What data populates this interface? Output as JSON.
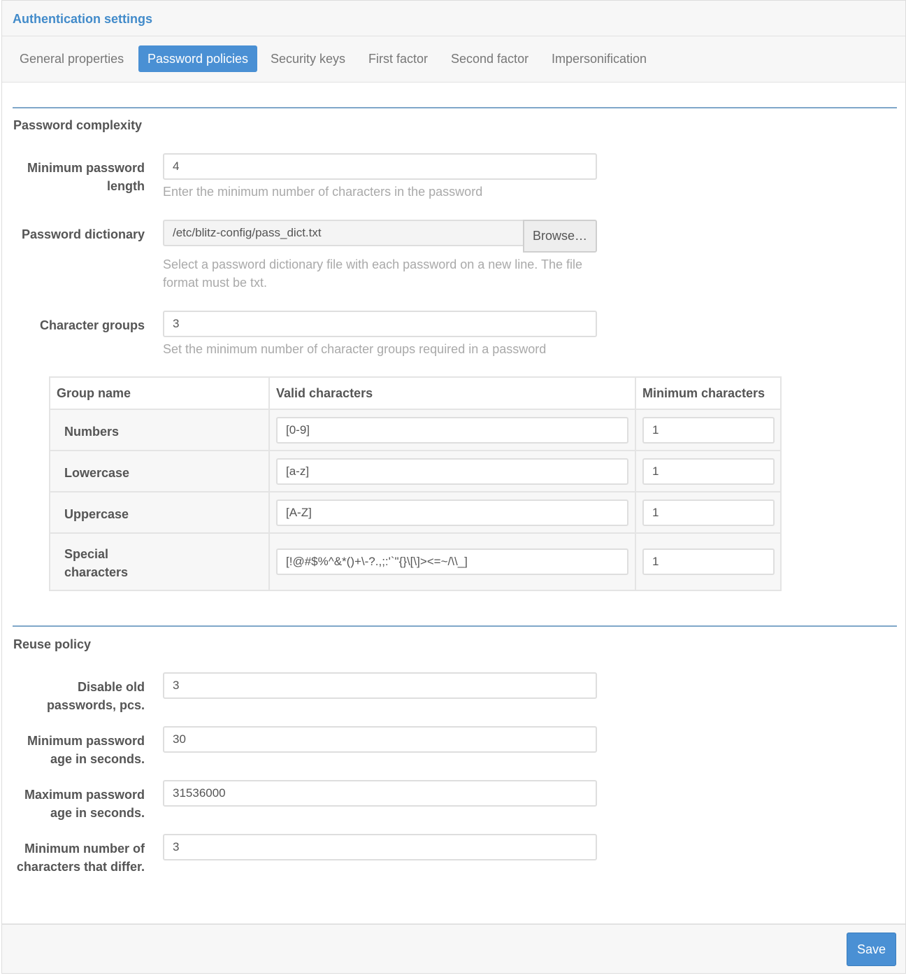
{
  "header": {
    "title": "Authentication settings"
  },
  "tabs": [
    {
      "label": "General properties",
      "active": false
    },
    {
      "label": "Password policies",
      "active": true
    },
    {
      "label": "Security keys",
      "active": false
    },
    {
      "label": "First factor",
      "active": false
    },
    {
      "label": "Second factor",
      "active": false
    },
    {
      "label": "Impersonification",
      "active": false
    }
  ],
  "complexity": {
    "title": "Password complexity",
    "min_length": {
      "label": "Minimum password length",
      "value": "4",
      "help": "Enter the minimum number of characters in the password"
    },
    "dictionary": {
      "label": "Password dictionary",
      "value": "/etc/blitz-config/pass_dict.txt",
      "browse": "Browse…",
      "help": "Select a password dictionary file with each password on a new line. The file format must be txt."
    },
    "groups": {
      "label": "Character groups",
      "value": "3",
      "help": "Set the minimum number of character groups required in a password"
    },
    "table": {
      "headers": {
        "name": "Group name",
        "valid": "Valid characters",
        "min": "Minimum characters"
      },
      "rows": [
        {
          "name": "Numbers",
          "valid": "[0-9]",
          "min": "1"
        },
        {
          "name": "Lowercase",
          "valid": "[a-z]",
          "min": "1"
        },
        {
          "name": "Uppercase",
          "valid": "[A-Z]",
          "min": "1"
        },
        {
          "name": "Special characters",
          "valid": "[!@#$%^&*()+\\-?.,;:'`\"{}\\[\\]><=~/\\\\_]",
          "min": "1"
        }
      ]
    }
  },
  "reuse": {
    "title": "Reuse policy",
    "disable_old": {
      "label": "Disable old passwords, pcs.",
      "value": "3"
    },
    "min_age": {
      "label": "Minimum password age in seconds.",
      "value": "30"
    },
    "max_age": {
      "label": "Maximum password age in seconds.",
      "value": "31536000"
    },
    "min_diff": {
      "label": "Minimum number of characters that differ.",
      "value": "3"
    }
  },
  "footer": {
    "save_label": "Save"
  },
  "colors": {
    "accent": "#4a90d4",
    "title": "#428bca",
    "help_text": "#a9a9a9"
  }
}
